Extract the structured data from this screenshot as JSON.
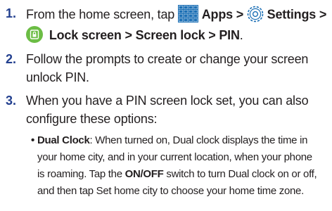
{
  "steps": [
    {
      "number": "1.",
      "line1": {
        "prefix": "From the home screen, tap ",
        "apps_label": "Apps",
        "sep1": " > ",
        "settings_label": "Settings",
        "sep2": " >"
      },
      "line2": {
        "lock_screen": "Lock screen",
        "sep3": " > ",
        "screen_lock": "Screen lock",
        "sep4": " > ",
        "pin": "PIN",
        "end": "."
      }
    },
    {
      "number": "2.",
      "line1": "Follow the prompts to create or change your screen",
      "line2": "unlock PIN."
    },
    {
      "number": "3.",
      "line1": "When you have a PIN screen lock set, you can also",
      "line2": "configure these options:"
    }
  ],
  "bullet": {
    "symbol": "•",
    "term": "Dual Clock",
    "line1_rest": ": When turned on, Dual clock displays the time in",
    "line2": "your home city, and in your current location, when your phone",
    "line3": "is roaming. Tap the ",
    "onoff": "ON/OFF",
    "line3_rest": " switch to turn Dual clock on or off,",
    "line4": "and then tap Set home city to choose your home time zone."
  },
  "icons": {
    "apps": "apps-grid-icon",
    "settings": "settings-gear-icon",
    "lock_screen": "lock-screen-icon"
  },
  "colors": {
    "step_number": "#23408f",
    "apps_icon": "#1b6fb5",
    "settings_icon": "#1b6fb5",
    "lock_screen_icon": "#6cbd45",
    "text": "#231f20"
  }
}
